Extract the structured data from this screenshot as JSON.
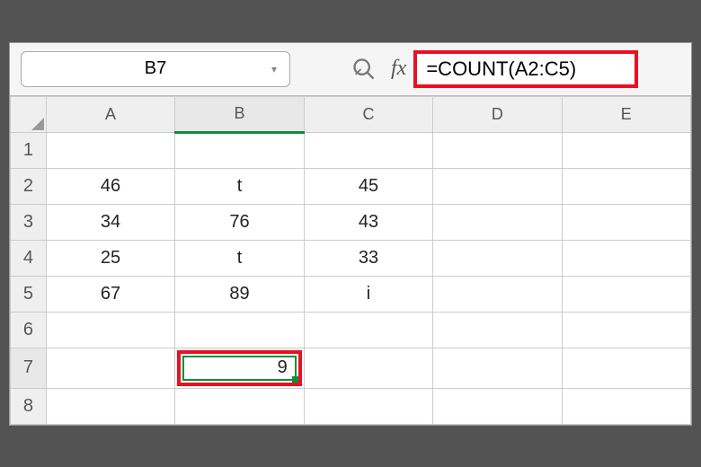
{
  "name_box": "B7",
  "formula": "=COUNT(A2:C5)",
  "columns": [
    "A",
    "B",
    "C",
    "D",
    "E"
  ],
  "rows": [
    "1",
    "2",
    "3",
    "4",
    "5",
    "6",
    "7",
    "8"
  ],
  "active_cell_value": "9",
  "cells": {
    "r2": {
      "A": "46",
      "B": "t",
      "C": "45"
    },
    "r3": {
      "A": "34",
      "B": "76",
      "C": "43"
    },
    "r4": {
      "A": "25",
      "B": "t",
      "C": "33"
    },
    "r5": {
      "A": "67",
      "B": "89",
      "C": "i"
    }
  },
  "chart_data": {
    "type": "table",
    "title": "Spreadsheet showing COUNT function",
    "columns": [
      "A",
      "B",
      "C"
    ],
    "rows": [
      {
        "A": 46,
        "B": "t",
        "C": 45
      },
      {
        "A": 34,
        "B": 76,
        "C": 43
      },
      {
        "A": 25,
        "B": "t",
        "C": 33
      },
      {
        "A": 67,
        "B": 89,
        "C": "i"
      }
    ],
    "formula_cell": {
      "ref": "B7",
      "formula": "=COUNT(A2:C5)",
      "result": 9
    }
  }
}
